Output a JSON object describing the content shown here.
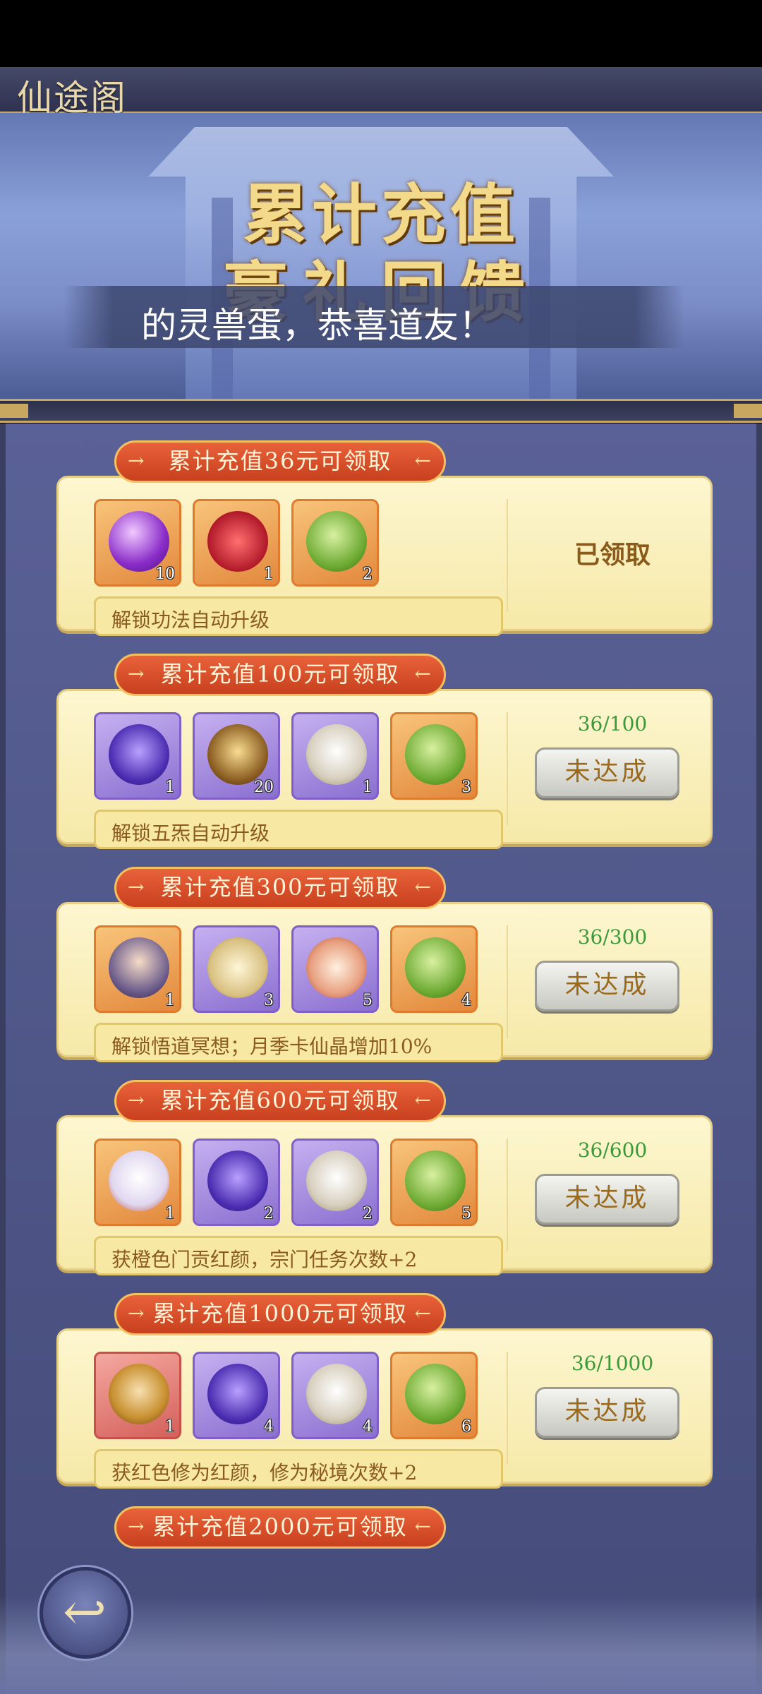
{
  "header": {
    "title": "仙途阁"
  },
  "banner": {
    "heading": "累计充值",
    "subheading": "豪礼回馈",
    "marquee": "的灵兽蛋，恭喜道友！"
  },
  "colors": {
    "ribbon": "#d4502a",
    "card": "#fbf1bf",
    "progress_text": "#3a9a3a",
    "panel_bg": "#545b8f"
  },
  "tiers": [
    {
      "title": "累计充值36元可领取",
      "perk": "解锁功法自动升级",
      "status": "已领取",
      "progress": "",
      "button": "",
      "items": [
        {
          "icon": "purple-orb-icon",
          "count": "10",
          "rarity": "orange"
        },
        {
          "icon": "red-cloth-icon",
          "count": "1",
          "rarity": "orange"
        },
        {
          "icon": "green-ewer-icon",
          "count": "2",
          "rarity": "orange"
        }
      ]
    },
    {
      "title": "累计充值100元可领取",
      "perk": "解锁五炁自动升级",
      "status": "",
      "progress": "36/100",
      "button": "未达成",
      "items": [
        {
          "icon": "purple-talisman-icon",
          "count": "1",
          "rarity": "purple"
        },
        {
          "icon": "gold-ore-icon",
          "count": "20",
          "rarity": "purple"
        },
        {
          "icon": "spirit-egg-icon",
          "count": "1",
          "rarity": "purple"
        },
        {
          "icon": "green-ewer-icon",
          "count": "3",
          "rarity": "orange"
        }
      ]
    },
    {
      "title": "累计充值300元可领取",
      "perk": "解锁悟道冥想；月季卡仙晶增加10%",
      "status": "",
      "progress": "36/300",
      "button": "未达成",
      "items": [
        {
          "icon": "immortal-portrait-icon",
          "count": "1",
          "rarity": "orange"
        },
        {
          "icon": "scroll-icon",
          "count": "3",
          "rarity": "purple"
        },
        {
          "icon": "fire-talisman-icon",
          "count": "5",
          "rarity": "purple"
        },
        {
          "icon": "green-ewer-icon",
          "count": "4",
          "rarity": "orange"
        }
      ]
    },
    {
      "title": "累计充值600元可领取",
      "perk": "获橙色门贡红颜，宗门任务次数+2",
      "status": "",
      "progress": "36/600",
      "button": "未达成",
      "items": [
        {
          "icon": "fox-mask-icon",
          "count": "1",
          "rarity": "orange"
        },
        {
          "icon": "purple-talisman-icon",
          "count": "2",
          "rarity": "purple"
        },
        {
          "icon": "spirit-egg-icon",
          "count": "2",
          "rarity": "purple"
        },
        {
          "icon": "green-ewer-icon",
          "count": "5",
          "rarity": "orange"
        }
      ]
    },
    {
      "title": "累计充值1000元可领取",
      "perk": "获红色修为红颜，修为秘境次数+2",
      "status": "",
      "progress": "36/1000",
      "button": "未达成",
      "items": [
        {
          "icon": "bell-portrait-icon",
          "count": "1",
          "rarity": "red"
        },
        {
          "icon": "purple-talisman-icon",
          "count": "4",
          "rarity": "purple"
        },
        {
          "icon": "spirit-egg-icon",
          "count": "4",
          "rarity": "purple"
        },
        {
          "icon": "green-ewer-icon",
          "count": "6",
          "rarity": "orange"
        }
      ]
    },
    {
      "title": "累计充值2000元可领取"
    }
  ]
}
